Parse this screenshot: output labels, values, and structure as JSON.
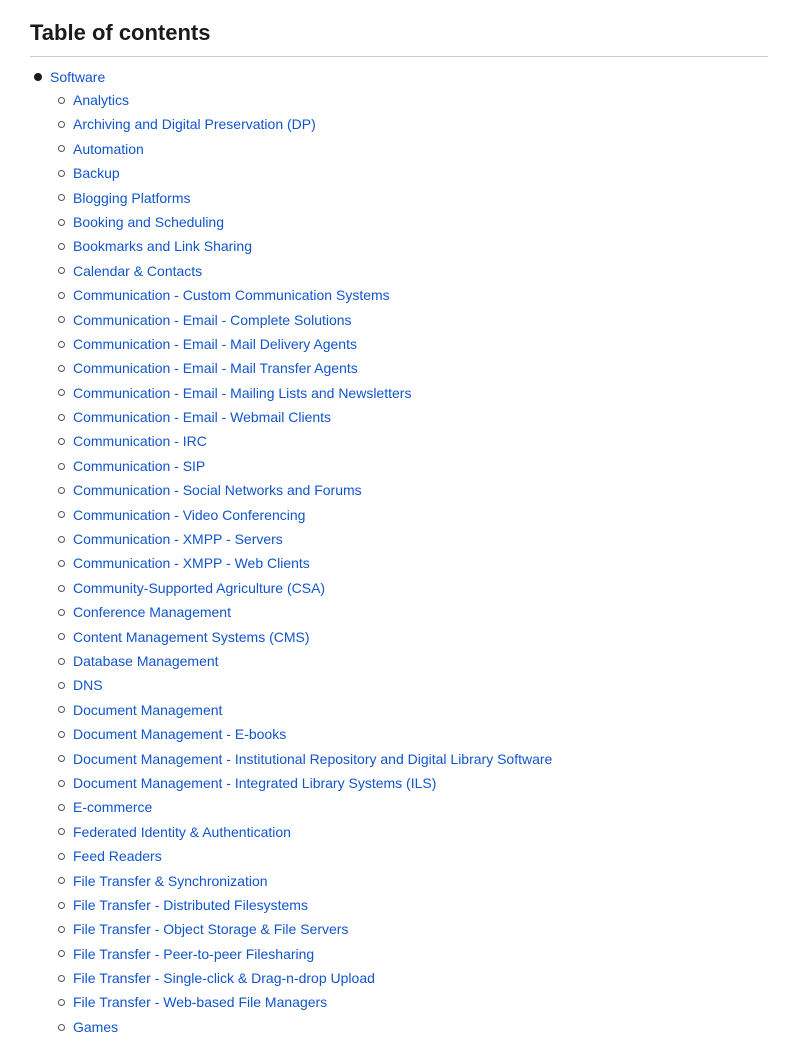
{
  "page": {
    "title": "Table of contents"
  },
  "toc": {
    "top_level": [
      {
        "label": "Software",
        "items": [
          "Analytics",
          "Archiving and Digital Preservation (DP)",
          "Automation",
          "Backup",
          "Blogging Platforms",
          "Booking and Scheduling",
          "Bookmarks and Link Sharing",
          "Calendar & Contacts",
          "Communication - Custom Communication Systems",
          "Communication - Email - Complete Solutions",
          "Communication - Email - Mail Delivery Agents",
          "Communication - Email - Mail Transfer Agents",
          "Communication - Email - Mailing Lists and Newsletters",
          "Communication - Email - Webmail Clients",
          "Communication - IRC",
          "Communication - SIP",
          "Communication - Social Networks and Forums",
          "Communication - Video Conferencing",
          "Communication - XMPP - Servers",
          "Communication - XMPP - Web Clients",
          "Community-Supported Agriculture (CSA)",
          "Conference Management",
          "Content Management Systems (CMS)",
          "Database Management",
          "DNS",
          "Document Management",
          "Document Management - E-books",
          "Document Management - Institutional Repository and Digital Library Software",
          "Document Management - Integrated Library Systems (ILS)",
          "E-commerce",
          "Federated Identity & Authentication",
          "Feed Readers",
          "File Transfer & Synchronization",
          "File Transfer - Distributed Filesystems",
          "File Transfer - Object Storage & File Servers",
          "File Transfer - Peer-to-peer Filesharing",
          "File Transfer - Single-click & Drag-n-drop Upload",
          "File Transfer - Web-based File Managers",
          "Games"
        ]
      }
    ]
  }
}
